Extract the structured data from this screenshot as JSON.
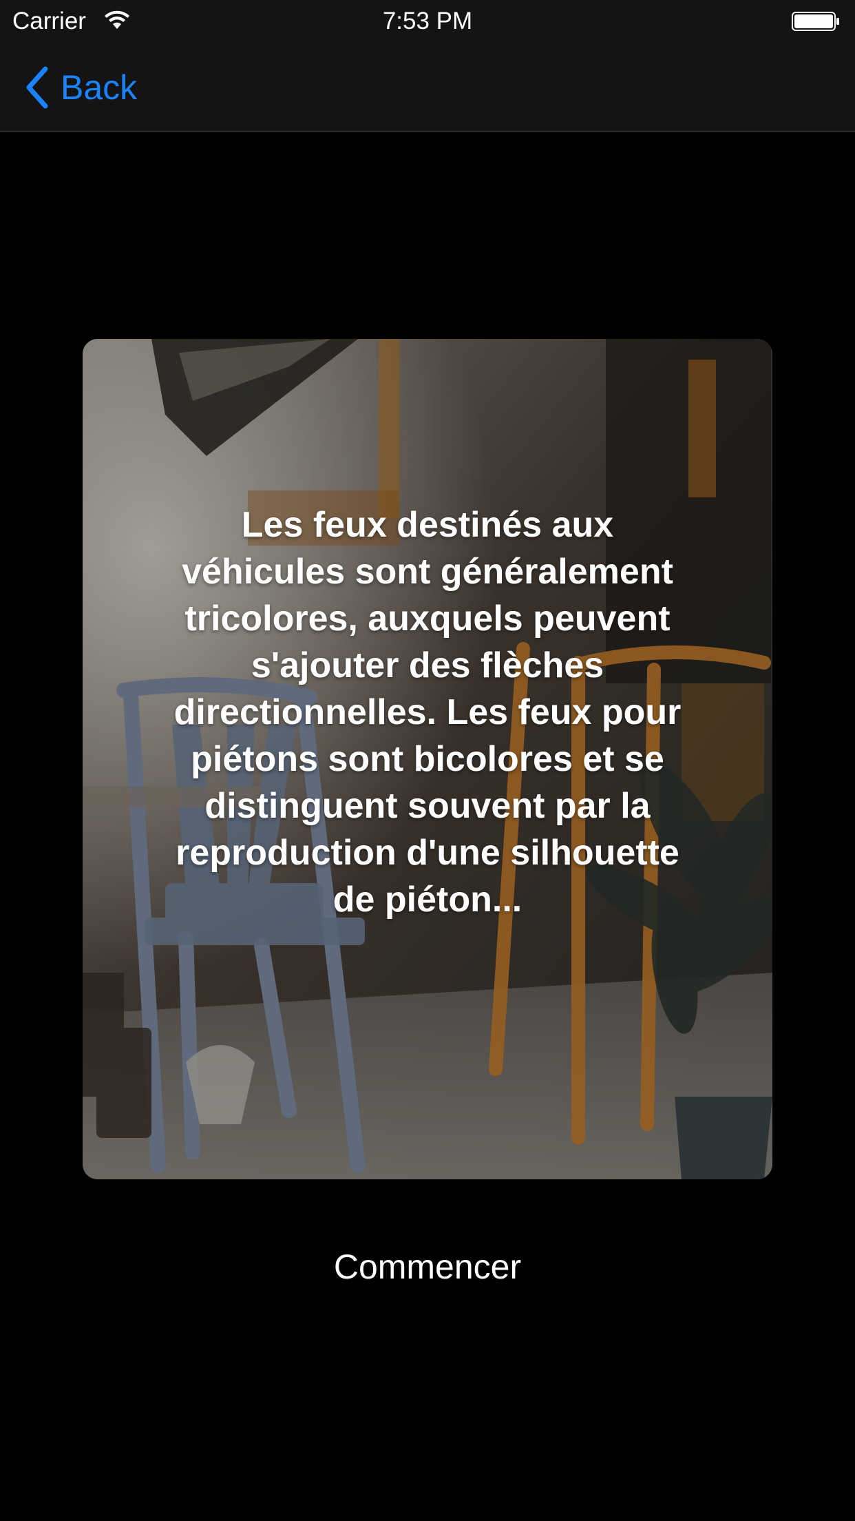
{
  "status_bar": {
    "carrier": "Carrier",
    "time": "7:53 PM",
    "wifi_icon": "wifi-icon",
    "battery_icon": "battery-icon"
  },
  "nav": {
    "back_label": "Back",
    "back_icon": "chevron-left-icon",
    "accent_color": "#1a84ff"
  },
  "card": {
    "background_image": "cafe-terrace-chairs-photo",
    "text": "Les feux destinés aux véhicules sont généralement tricolores, auxquels peuvent s'ajouter des flèches directionnelles. Les feux pour piétons sont bicolores et se distinguent souvent par la reproduction d'une silhouette de piéton..."
  },
  "start_button": {
    "label": "Commencer"
  }
}
